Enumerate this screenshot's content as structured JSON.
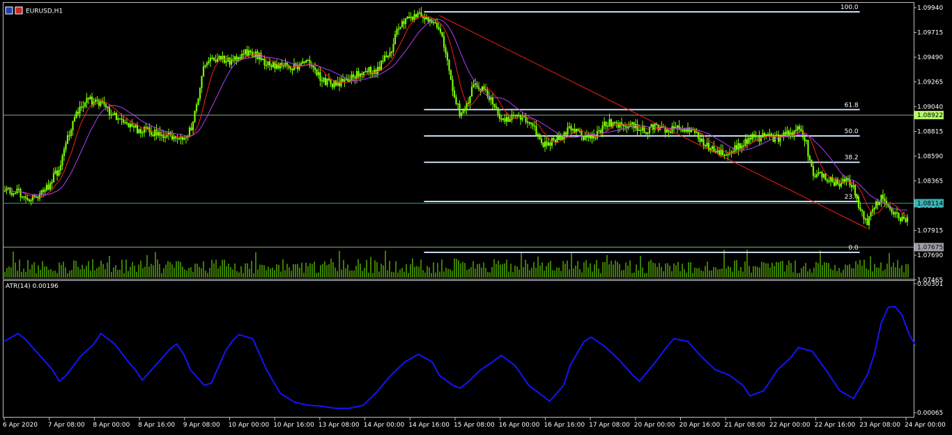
{
  "window": {
    "symbol_title": "EURUSD,H1"
  },
  "colors": {
    "background": "#000000",
    "frame": "#c0c0c0",
    "bull": "#7cfc00",
    "ma_fast": "#ff1e1e",
    "ma_slow": "#b040ff",
    "trend_line": "#ff1e1e",
    "fib": "#c8dcf0",
    "hline": "#a0d0a0",
    "atr": "#1414ff",
    "text": "#ffffff",
    "label_green": "#b4ff64",
    "label_teal": "#3cb4b4",
    "label_gray": "#a0a0aa"
  },
  "chart_data": [
    {
      "type": "candlestick",
      "title": "EURUSD,H1",
      "ylim": [
        1.074,
        1.0994
      ],
      "price_ticks": [
        "1.09940",
        "1.09715",
        "1.09490",
        "1.09265",
        "1.09040",
        "1.08815",
        "1.08590",
        "1.08365",
        "1.08140",
        "1.07915",
        "1.07690",
        "1.07465"
      ],
      "time_ticks": [
        "6 Apr 2020",
        "7 Apr 08:00",
        "8 Apr 00:00",
        "8 Apr 16:00",
        "9 Apr 08:00",
        "10 Apr 00:00",
        "10 Apr 16:00",
        "13 Apr 08:00",
        "14 Apr 00:00",
        "14 Apr 16:00",
        "15 Apr 08:00",
        "16 Apr 00:00",
        "16 Apr 16:00",
        "17 Apr 08:00",
        "20 Apr 00:00",
        "20 Apr 16:00",
        "21 Apr 08:00",
        "22 Apr 00:00",
        "22 Apr 16:00",
        "23 Apr 08:00",
        "24 Apr 00:00"
      ],
      "close_path": [
        [
          0,
          1.0806
        ],
        [
          2,
          1.0805
        ],
        [
          4,
          1.0798
        ],
        [
          6,
          1.0807
        ],
        [
          8,
          1.083
        ],
        [
          9,
          1.0855
        ],
        [
          10,
          1.088
        ],
        [
          11,
          1.0892
        ],
        [
          12,
          1.09
        ],
        [
          14,
          1.0896
        ],
        [
          16,
          1.0884
        ],
        [
          18,
          1.0872
        ],
        [
          20,
          1.0868
        ],
        [
          22,
          1.0866
        ],
        [
          24,
          1.0862
        ],
        [
          26,
          1.0862
        ],
        [
          27,
          1.0868
        ],
        [
          28,
          1.09
        ],
        [
          29,
          1.0938
        ],
        [
          31,
          1.0942
        ],
        [
          33,
          1.0938
        ],
        [
          35,
          1.0948
        ],
        [
          37,
          1.0944
        ],
        [
          38,
          1.0936
        ],
        [
          40,
          1.0934
        ],
        [
          42,
          1.0933
        ],
        [
          43,
          1.0936
        ],
        [
          44,
          1.094
        ],
        [
          46,
          1.092
        ],
        [
          48,
          1.0915
        ],
        [
          50,
          1.0922
        ],
        [
          52,
          1.093
        ],
        [
          54,
          1.093
        ],
        [
          56,
          1.095
        ],
        [
          57,
          1.0975
        ],
        [
          59,
          1.0984
        ],
        [
          61,
          1.0986
        ],
        [
          63,
          1.0975
        ],
        [
          64,
          1.0948
        ],
        [
          65,
          1.091
        ],
        [
          66,
          1.0885
        ],
        [
          67,
          1.0895
        ],
        [
          68,
          1.0918
        ],
        [
          70,
          1.0905
        ],
        [
          72,
          1.088
        ],
        [
          74,
          1.0882
        ],
        [
          76,
          1.0878
        ],
        [
          78,
          1.0855
        ],
        [
          80,
          1.0858
        ],
        [
          82,
          1.087
        ],
        [
          84,
          1.0862
        ],
        [
          86,
          1.0864
        ],
        [
          87,
          1.0876
        ],
        [
          88,
          1.0876
        ],
        [
          90,
          1.0874
        ],
        [
          92,
          1.0872
        ],
        [
          93,
          1.0868
        ],
        [
          94,
          1.0872
        ],
        [
          96,
          1.0868
        ],
        [
          98,
          1.087
        ],
        [
          100,
          1.0866
        ],
        [
          102,
          1.0852
        ],
        [
          104,
          1.0845
        ],
        [
          106,
          1.085
        ],
        [
          108,
          1.086
        ],
        [
          110,
          1.0862
        ],
        [
          112,
          1.086
        ],
        [
          114,
          1.0866
        ],
        [
          115,
          1.0875
        ],
        [
          116,
          1.086
        ],
        [
          117,
          1.0825
        ],
        [
          119,
          1.082
        ],
        [
          121,
          1.0813
        ],
        [
          122,
          1.082
        ],
        [
          123,
          1.0808
        ],
        [
          124,
          1.0785
        ],
        [
          125,
          1.0775
        ],
        [
          126,
          1.079
        ],
        [
          127,
          1.08
        ],
        [
          128,
          1.079
        ],
        [
          129,
          1.0782
        ],
        [
          130,
          1.0777
        ]
      ],
      "ma_fast_label": "",
      "ma_slow_label": "",
      "level_fractions": {
        "fib_100": 0.0,
        "fib_61_8": 0.394,
        "fib_50": 0.5,
        "fib_38_2": 0.606,
        "fib_23_6": 0.764,
        "fib_0": 0.969,
        "hline_top": 0.416,
        "hline_mid": 0.771,
        "hline_low": 0.948
      },
      "fib_labels": [
        "100.0",
        "61.8",
        "50.0",
        "38.2",
        "23.6",
        "0.0"
      ],
      "price_labels": [
        {
          "text": "1.08922",
          "style": "green"
        },
        {
          "text": "1.08114",
          "style": "teal"
        },
        {
          "text": "1.07675",
          "style": "gray"
        }
      ],
      "trend_line": {
        "from": [
          63,
          1.0986
        ],
        "to": [
          125,
          1.0768
        ]
      }
    },
    {
      "type": "line",
      "title": "ATR(14) 0.00196",
      "ylim": [
        0.00065,
        0.00301
      ],
      "ticks": [
        "0.00301",
        "0.00065"
      ],
      "values": [
        [
          0,
          0.00205
        ],
        [
          2,
          0.0022
        ],
        [
          3,
          0.0021
        ],
        [
          5,
          0.0018
        ],
        [
          7,
          0.0015
        ],
        [
          8,
          0.00128
        ],
        [
          9,
          0.0014
        ],
        [
          11,
          0.00175
        ],
        [
          13,
          0.002
        ],
        [
          14,
          0.0022
        ],
        [
          16,
          0.002
        ],
        [
          18,
          0.00165
        ],
        [
          19,
          0.0015
        ],
        [
          20,
          0.0013
        ],
        [
          22,
          0.0016
        ],
        [
          24,
          0.0019
        ],
        [
          25,
          0.002
        ],
        [
          26,
          0.0018
        ],
        [
          27,
          0.0015
        ],
        [
          29,
          0.0012
        ],
        [
          30,
          0.00125
        ],
        [
          32,
          0.00185
        ],
        [
          33,
          0.00205
        ],
        [
          34,
          0.00218
        ],
        [
          36,
          0.0021
        ],
        [
          38,
          0.0015
        ],
        [
          40,
          0.00105
        ],
        [
          42,
          0.00088
        ],
        [
          44,
          0.00082
        ],
        [
          46,
          0.0008
        ],
        [
          48,
          0.00076
        ],
        [
          50,
          0.00076
        ],
        [
          52,
          0.00082
        ],
        [
          54,
          0.00108
        ],
        [
          56,
          0.0014
        ],
        [
          58,
          0.00165
        ],
        [
          60,
          0.0018
        ],
        [
          62,
          0.00165
        ],
        [
          63,
          0.0014
        ],
        [
          65,
          0.0012
        ],
        [
          66,
          0.00115
        ],
        [
          67,
          0.00125
        ],
        [
          69,
          0.0015
        ],
        [
          71,
          0.00168
        ],
        [
          72,
          0.00178
        ],
        [
          74,
          0.00158
        ],
        [
          76,
          0.0012
        ],
        [
          78,
          0.001
        ],
        [
          79,
          0.0009
        ],
        [
          81,
          0.0012
        ],
        [
          82,
          0.0016
        ],
        [
          84,
          0.00205
        ],
        [
          85,
          0.00213
        ],
        [
          87,
          0.00195
        ],
        [
          89,
          0.0017
        ],
        [
          91,
          0.0014
        ],
        [
          92,
          0.00128
        ],
        [
          94,
          0.0016
        ],
        [
          96,
          0.00195
        ],
        [
          97,
          0.0021
        ],
        [
          99,
          0.00205
        ],
        [
          101,
          0.00175
        ],
        [
          103,
          0.0015
        ],
        [
          105,
          0.0014
        ],
        [
          107,
          0.0012
        ],
        [
          108,
          0.001
        ],
        [
          110,
          0.0011
        ],
        [
          112,
          0.0015
        ],
        [
          114,
          0.00175
        ],
        [
          115,
          0.00193
        ],
        [
          117,
          0.00186
        ],
        [
          119,
          0.0015
        ],
        [
          121,
          0.0011
        ],
        [
          123,
          0.00095
        ],
        [
          125,
          0.0014
        ],
        [
          126,
          0.0018
        ],
        [
          127,
          0.0024
        ],
        [
          128,
          0.0027
        ],
        [
          129,
          0.00272
        ],
        [
          130,
          0.00256
        ],
        [
          131,
          0.0022
        ],
        [
          132,
          0.00196
        ]
      ]
    }
  ]
}
